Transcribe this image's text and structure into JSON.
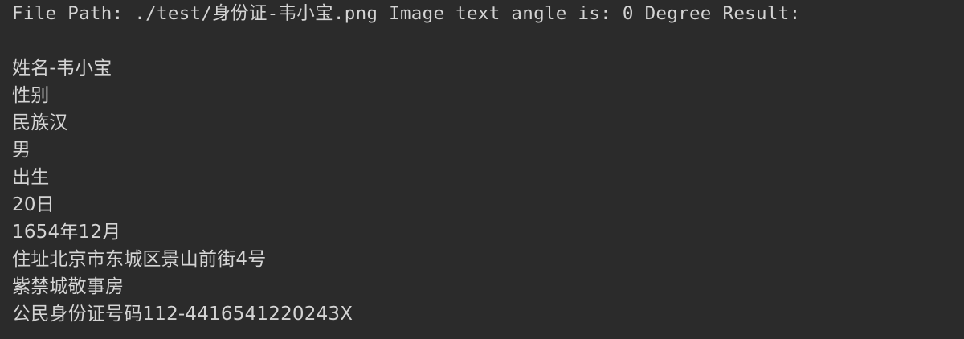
{
  "terminal": {
    "header": "File Path: ./test/身份证-韦小宝.png Image text angle is: 0 Degree Result:",
    "results": [
      "姓名-韦小宝",
      "性别",
      "民族汉",
      "男",
      "出生",
      "20日",
      "1654年12月",
      "住址北京市东城区景山前街4号",
      "紫禁城敬事房",
      "公民身份证号码112-4416541220243X"
    ]
  }
}
